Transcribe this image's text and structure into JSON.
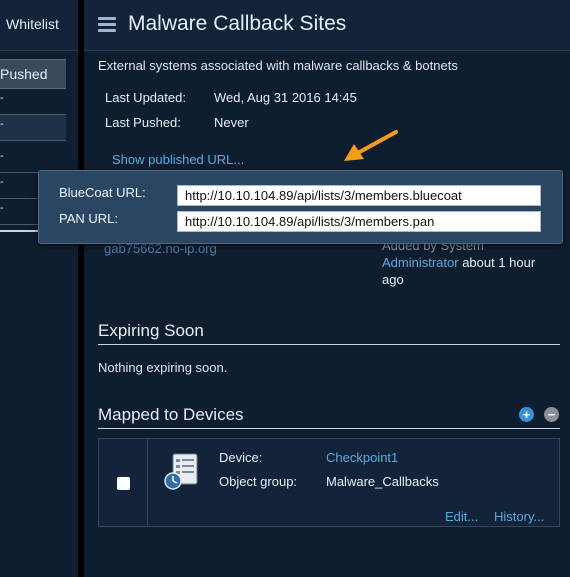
{
  "sidebar": {
    "header_label": "Whitelist",
    "pushed_label": "Pushed",
    "rows": [
      "-",
      "-",
      "-",
      "-",
      "-"
    ]
  },
  "header": {
    "title": "Malware Callback Sites"
  },
  "details": {
    "description": "External systems associated with malware callbacks & botnets",
    "last_updated_label": "Last Updated:",
    "last_updated_value": "Wed, Aug 31 2016 14:45",
    "last_pushed_label": "Last Pushed:",
    "last_pushed_value": "Never",
    "show_url_link": "Show published URL..."
  },
  "popover": {
    "bluecoat_label": "BlueCoat URL:",
    "bluecoat_url": "http://10.10.104.89/api/lists/3/members.bluecoat",
    "pan_label": "PAN URL:",
    "pan_url": "http://10.10.104.89/api/lists/3/members.pan"
  },
  "obscured": {
    "member_host": "gab75662.no-ip.org",
    "added_by_prefix": "Added by System",
    "added_by_user": "Administrator",
    "added_by_suffix": " about 1 hour",
    "added_by_ago": "ago"
  },
  "expiring": {
    "title": "Expiring Soon",
    "empty_text": "Nothing expiring soon."
  },
  "mapped": {
    "title": "Mapped to Devices",
    "add_symbol": "+",
    "remove_symbol": "−",
    "device_label": "Device:",
    "device_value": "Checkpoint1",
    "group_label": "Object group:",
    "group_value": "Malware_Callbacks",
    "edit_link": "Edit...",
    "history_link": "History..."
  },
  "colors": {
    "link": "#5aaae0",
    "accent_arrow": "#f39c1e",
    "add_button": "#3a8fd8",
    "remove_button": "#8a8f96"
  }
}
